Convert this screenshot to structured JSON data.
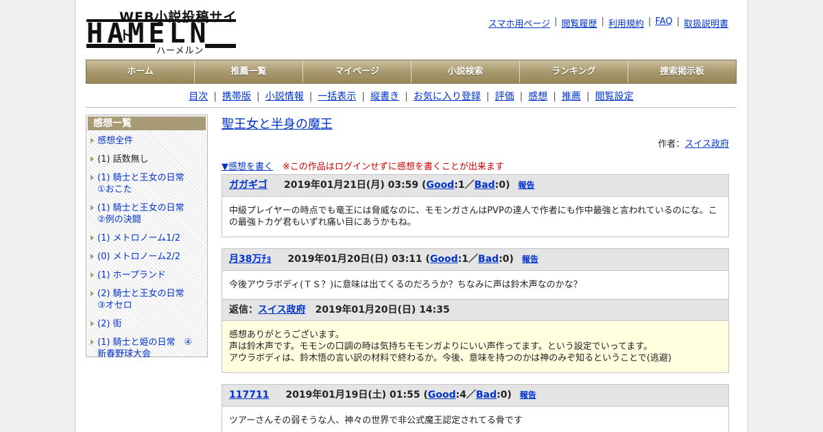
{
  "logo": {
    "tagline": "WEB小説投稿サイト",
    "name": "HAMELN",
    "kana": "ハーメルン"
  },
  "top_links": [
    "スマホ用ページ",
    "閲覧履歴",
    "利用規約",
    "FAQ",
    "取扱説明書"
  ],
  "nav": [
    "ホーム",
    "推薦一覧",
    "マイページ",
    "小説検索",
    "ランキング",
    "捜索掲示板"
  ],
  "subnav": [
    "目次",
    "携帯版",
    "小説情報",
    "一括表示",
    "縦書き",
    "お気に入り登録",
    "評価",
    "感想",
    "推薦",
    "閲覧設定"
  ],
  "sidebar": {
    "title": "感想一覧",
    "items": [
      {
        "label": "感想全件",
        "link": true
      },
      {
        "label": "(1) 話数無し",
        "link": false
      },
      {
        "label": "(1) 騎士と王女の日常　①おこた",
        "link": true
      },
      {
        "label": "(1) 騎士と王女の日常　②例の決闘",
        "link": true
      },
      {
        "label": "(1) メトロノーム1/2",
        "link": true
      },
      {
        "label": "(0) メトロノーム2/2",
        "link": true
      },
      {
        "label": "(1) ホープランド",
        "link": true
      },
      {
        "label": "(2) 騎士と王女の日常　③オセロ",
        "link": true
      },
      {
        "label": "(2) 街",
        "link": true
      },
      {
        "label": "(1) 騎士と姫の日常　④新春野球大会",
        "link": true
      }
    ]
  },
  "work": {
    "title": "聖王女と半身の魔王",
    "author_label": "作者：",
    "author": "スイス政府",
    "write_link": "▼感想を書く",
    "write_note": "※この作品はログインせずに感想を書くことが出来ます"
  },
  "review_labels": {
    "good": "Good",
    "bad": "Bad",
    "report": "報告",
    "reply_label": "返信："
  },
  "reviews": [
    {
      "user": "ガガギゴ",
      "date": "2019年01月21日(月) 03:59",
      "good": "1",
      "bad": "0",
      "body": [
        "中級プレイヤーの時点でも竜王には脅威なのに、モモンガさんはPVPの達人で作者にも作中最強と言われているのにな。この最強トカゲ君もいずれ痛い目にあうかもね。"
      ]
    },
    {
      "user": "月38万ﾁｮ",
      "date": "2019年01月20日(日) 03:11",
      "good": "1",
      "bad": "0",
      "body": [
        "今後アウラボディ(ＴＳ？)に意味は出てくるのだろうか？ちなみに声は鈴木声なのかな？"
      ],
      "reply": {
        "user": "スイス政府",
        "date": "2019年01月20日(日) 14:35",
        "body": [
          "感想ありがとうございます。",
          "声は鈴木声です。モモンの口調の時は気持ちモモンガよりにいい声作ってます。という設定でいってます。",
          "アウラボディは、鈴木悟の言い訳の材料で終わるか。今後、意味を持つのかは神のみぞ知るということで(逃避)"
        ]
      }
    },
    {
      "user": "117711",
      "date": "2019年01月19日(土) 01:55",
      "good": "4",
      "bad": "0",
      "body": [
        "ツアーさんその弱そうな人、神々の世界で非公式魔王認定されてる骨です"
      ]
    }
  ]
}
